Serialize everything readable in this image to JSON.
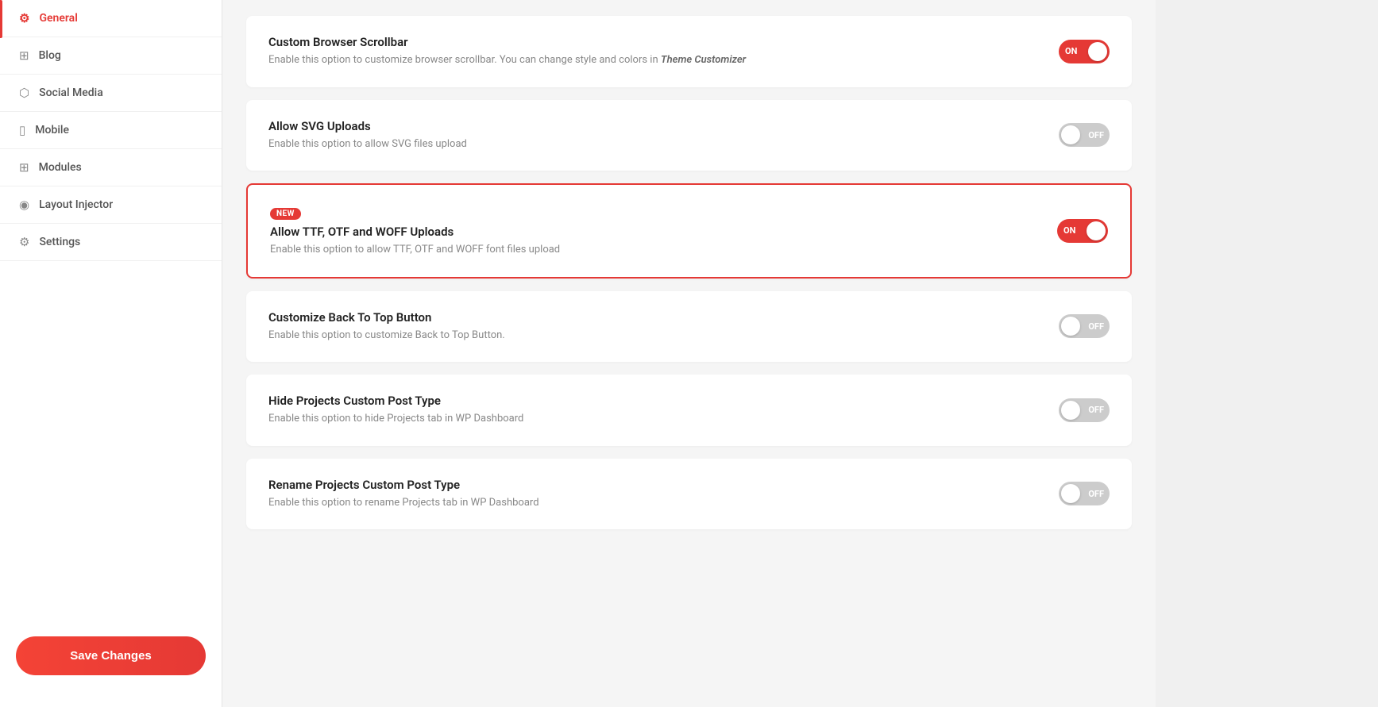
{
  "sidebar": {
    "items": [
      {
        "id": "general",
        "label": "General",
        "icon": "⚙",
        "active": true
      },
      {
        "id": "blog",
        "label": "Blog",
        "icon": "▦",
        "active": false
      },
      {
        "id": "social-media",
        "label": "Social Media",
        "icon": "⬡",
        "active": false
      },
      {
        "id": "mobile",
        "label": "Mobile",
        "icon": "📱",
        "active": false
      },
      {
        "id": "modules",
        "label": "Modules",
        "icon": "▣",
        "active": false
      },
      {
        "id": "layout-injector",
        "label": "Layout Injector",
        "icon": "◎",
        "active": false
      },
      {
        "id": "settings",
        "label": "Settings",
        "icon": "⚙",
        "active": false
      }
    ],
    "save_button_label": "Save Changes"
  },
  "settings": [
    {
      "id": "custom-browser-scrollbar",
      "title": "Custom Browser Scrollbar",
      "desc_plain": "Enable this option to customize browser scrollbar. You can change style and colors in ",
      "desc_link": "Theme Customizer",
      "toggle": "on",
      "highlighted": false,
      "new_badge": false
    },
    {
      "id": "allow-svg-uploads",
      "title": "Allow SVG Uploads",
      "desc_plain": "Enable this option to allow SVG files upload",
      "desc_link": "",
      "toggle": "off",
      "highlighted": false,
      "new_badge": false
    },
    {
      "id": "allow-ttf-otf-woff",
      "title": "Allow TTF, OTF and WOFF Uploads",
      "desc_plain": "Enable this option to allow TTF, OTF and WOFF font files upload",
      "desc_link": "",
      "toggle": "on",
      "highlighted": true,
      "new_badge": true,
      "new_label": "NEW"
    },
    {
      "id": "customize-back-to-top",
      "title": "Customize Back To Top Button",
      "desc_plain": "Enable this option to customize Back to Top Button.",
      "desc_link": "",
      "toggle": "off",
      "highlighted": false,
      "new_badge": false
    },
    {
      "id": "hide-projects-cpt",
      "title": "Hide Projects Custom Post Type",
      "desc_plain": "Enable this option to hide Projects tab in WP Dashboard",
      "desc_link": "",
      "toggle": "off",
      "highlighted": false,
      "new_badge": false
    },
    {
      "id": "rename-projects-cpt",
      "title": "Rename Projects Custom Post Type",
      "desc_plain": "Enable this option to rename Projects tab in WP Dashboard",
      "desc_link": "",
      "toggle": "off",
      "highlighted": false,
      "new_badge": false
    }
  ],
  "colors": {
    "accent": "#e53935",
    "toggle_on": "#e53935",
    "toggle_off": "#cccccc"
  }
}
